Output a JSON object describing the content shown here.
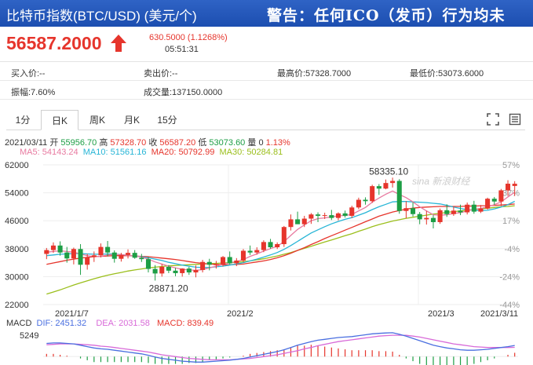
{
  "header": {
    "title": "比特币指数(BTC/USD) (美元/个)",
    "warning": "警告：任何ICO（发币）行为均未"
  },
  "quote": {
    "price": "56587.2000",
    "change": "630.5000 (1.1268%)",
    "time": "05:51:31"
  },
  "stats": {
    "bid": "买入价:--",
    "ask": "卖出价:--",
    "high": "最高价:57328.7000",
    "low": "最低价:53073.6000",
    "amplitude": "振幅:7.60%",
    "volume": "成交量:137150.0000"
  },
  "tabs": [
    "1分",
    "日K",
    "周K",
    "月K",
    "15分"
  ],
  "active_tab": "日K",
  "ohlc": {
    "date": "2021/03/11",
    "open_label": "开",
    "open": "55956.70",
    "high_label": "高",
    "high": "57328.70",
    "close_label": "收",
    "close": "56587.20",
    "low_label": "低",
    "low": "53073.60",
    "vol_label": "量",
    "vol": "0",
    "pct": "1.13%"
  },
  "ma": {
    "ma5": "MA5: 54143.24",
    "ma10": "MA10: 51561.16",
    "ma20": "MA20: 50792.99",
    "ma30": "MA30: 50284.81"
  },
  "macd": {
    "label": "MACD",
    "dif": "DIF: 2451.32",
    "dea": "DEA: 2031.58",
    "macd": "MACD: 839.49",
    "axis_max": "5249"
  },
  "watermark": "sina 新浪财经",
  "colors": {
    "up": "#e6352c",
    "down": "#1d9e45",
    "ma5": "#e87aa0",
    "ma10": "#27b5d6",
    "ma20": "#e6352c",
    "ma30": "#9bbf1c",
    "dif": "#4a6fe0",
    "dea": "#d86ad8"
  },
  "chart_data": {
    "type": "candlestick",
    "y_ticks": [
      "62000",
      "54000",
      "46000",
      "38000",
      "30000",
      "22000"
    ],
    "pct_ticks": [
      "57%",
      "37%",
      "17%",
      "-4%",
      "-24%",
      "-44%"
    ],
    "x_labels": [
      "2021/1/7",
      "2021/2",
      "2021/3",
      "2021/3/11"
    ],
    "annotations": {
      "max": "58335.10",
      "min": "28871.20"
    },
    "ylim": [
      22000,
      62000
    ],
    "candles": [
      [
        36500,
        38200,
        35000,
        37600
      ],
      [
        37600,
        39800,
        36800,
        38900
      ],
      [
        38900,
        40100,
        36000,
        36900
      ],
      [
        36900,
        38500,
        34000,
        35200
      ],
      [
        35200,
        38300,
        33500,
        37900
      ],
      [
        37900,
        39300,
        30500,
        33400
      ],
      [
        33400,
        36500,
        32000,
        35600
      ],
      [
        35600,
        37200,
        34200,
        36100
      ],
      [
        36100,
        39500,
        35500,
        38500
      ],
      [
        38500,
        40200,
        35800,
        36900
      ],
      [
        36900,
        37500,
        34000,
        35100
      ],
      [
        35100,
        36800,
        34300,
        36200
      ],
      [
        36200,
        37800,
        35200,
        36800
      ],
      [
        36800,
        37600,
        35100,
        35400
      ],
      [
        35400,
        36500,
        34200,
        35000
      ],
      [
        35000,
        35600,
        31200,
        32200
      ],
      [
        32200,
        33300,
        28871,
        30900
      ],
      [
        30900,
        33600,
        30000,
        32800
      ],
      [
        32800,
        33300,
        31000,
        31700
      ],
      [
        31700,
        32500,
        30100,
        31000
      ],
      [
        31000,
        32400,
        30000,
        32300
      ],
      [
        32300,
        32800,
        30500,
        31200
      ],
      [
        31200,
        33200,
        29800,
        31900
      ],
      [
        31900,
        34800,
        31200,
        34200
      ],
      [
        34200,
        35100,
        31800,
        33400
      ],
      [
        33400,
        34500,
        32300,
        33500
      ],
      [
        33500,
        35900,
        32900,
        35600
      ],
      [
        35600,
        37200,
        33500,
        33800
      ],
      [
        33800,
        35300,
        33000,
        34600
      ],
      [
        34600,
        37900,
        34100,
        37400
      ],
      [
        37400,
        38900,
        36200,
        36900
      ],
      [
        36900,
        38400,
        36300,
        37600
      ],
      [
        37600,
        40400,
        37000,
        39900
      ],
      [
        39900,
        40800,
        38000,
        38400
      ],
      [
        38400,
        39800,
        37900,
        39300
      ],
      [
        39300,
        44500,
        38500,
        44200
      ],
      [
        44200,
        47800,
        43200,
        46400
      ],
      [
        46400,
        48600,
        45200,
        45000
      ],
      [
        45000,
        47400,
        44200,
        46600
      ],
      [
        46600,
        48200,
        45100,
        47800
      ],
      [
        47800,
        48400,
        45600,
        47400
      ],
      [
        47400,
        48300,
        46500,
        47600
      ],
      [
        47600,
        49100,
        46200,
        46800
      ],
      [
        46800,
        48400,
        46100,
        48100
      ],
      [
        48100,
        48900,
        46900,
        47400
      ],
      [
        47400,
        50300,
        46800,
        49800
      ],
      [
        49800,
        52600,
        49300,
        52000
      ],
      [
        52000,
        52700,
        50600,
        51600
      ],
      [
        51600,
        56300,
        51100,
        55900
      ],
      [
        55900,
        56500,
        53400,
        55200
      ],
      [
        55200,
        57800,
        55000,
        56800
      ],
      [
        56800,
        58335,
        55500,
        57400
      ],
      [
        57400,
        57900,
        48000,
        48800
      ],
      [
        48800,
        51600,
        46700,
        49600
      ],
      [
        49600,
        51300,
        47200,
        47900
      ],
      [
        47900,
        48500,
        45000,
        46400
      ],
      [
        46400,
        48800,
        44900,
        46800
      ],
      [
        46800,
        47600,
        43800,
        45600
      ],
      [
        45600,
        49500,
        45100,
        49000
      ],
      [
        49000,
        50700,
        47100,
        47900
      ],
      [
        47900,
        50200,
        47400,
        48900
      ],
      [
        48900,
        50600,
        47600,
        48400
      ],
      [
        48400,
        51200,
        47800,
        50600
      ],
      [
        50600,
        51700,
        48000,
        48600
      ],
      [
        48600,
        50500,
        48200,
        49500
      ],
      [
        49500,
        52600,
        49200,
        52300
      ],
      [
        52300,
        52800,
        50600,
        51500
      ],
      [
        51500,
        55100,
        50200,
        54700
      ],
      [
        54700,
        57600,
        53100,
        56600
      ],
      [
        55956,
        57328,
        53073,
        56587
      ]
    ],
    "ma5": [
      37000,
      37200,
      37400,
      37200,
      37000,
      36500,
      36000,
      35700,
      35800,
      36200,
      36400,
      36300,
      36100,
      35900,
      35600,
      35000,
      34200,
      33600,
      33000,
      32500,
      32100,
      31900,
      31800,
      32000,
      32500,
      33000,
      33500,
      34000,
      34300,
      34900,
      35800,
      36500,
      37300,
      38000,
      38700,
      40000,
      41800,
      43500,
      44800,
      46000,
      46600,
      46800,
      47100,
      47400,
      47500,
      47800,
      48800,
      49800,
      51300,
      52500,
      53600,
      54500,
      53500,
      52600,
      51400,
      50000,
      48800,
      47700,
      47600,
      47700,
      48100,
      48300,
      48800,
      49300,
      49500,
      50000,
      50600,
      51400,
      52800,
      54143
    ],
    "ma10": [
      36000,
      36200,
      36400,
      36500,
      36600,
      36600,
      36500,
      36400,
      36400,
      36500,
      36500,
      36300,
      36100,
      35900,
      35700,
      35400,
      35000,
      34600,
      34100,
      33700,
      33300,
      33000,
      32700,
      32600,
      32600,
      32800,
      33000,
      33300,
      33600,
      34000,
      34500,
      35000,
      35600,
      36200,
      36900,
      37800,
      38900,
      40100,
      41300,
      42500,
      43400,
      44300,
      45100,
      45800,
      46400,
      46900,
      47600,
      48300,
      49200,
      50000,
      50700,
      51400,
      51500,
      51500,
      51400,
      51300,
      51200,
      51000,
      50800,
      50400,
      49900,
      49500,
      49200,
      49000,
      48900,
      49000,
      49400,
      49900,
      50600,
      51561
    ],
    "ma20": [
      33500,
      33900,
      34300,
      34700,
      35000,
      35300,
      35500,
      35700,
      35800,
      35900,
      36000,
      36000,
      36000,
      35900,
      35800,
      35700,
      35500,
      35300,
      35100,
      34900,
      34600,
      34300,
      34000,
      33800,
      33600,
      33500,
      33400,
      33400,
      33500,
      33600,
      33900,
      34200,
      34500,
      34900,
      35400,
      36000,
      36700,
      37500,
      38300,
      39200,
      40000,
      40900,
      41700,
      42500,
      43300,
      44100,
      44900,
      45700,
      46500,
      47300,
      47900,
      48500,
      48900,
      49300,
      49600,
      49800,
      49900,
      50000,
      50100,
      50100,
      50100,
      50100,
      50200,
      50200,
      50300,
      50300,
      50400,
      50500,
      50600,
      50793
    ],
    "ma30": [
      25000,
      25600,
      26200,
      26900,
      27600,
      28200,
      28800,
      29400,
      29900,
      30400,
      30800,
      31200,
      31600,
      31900,
      32200,
      32500,
      32700,
      32900,
      33100,
      33200,
      33300,
      33400,
      33500,
      33600,
      33700,
      33800,
      33900,
      34000,
      34100,
      34300,
      34500,
      34800,
      35100,
      35500,
      35900,
      36400,
      36900,
      37500,
      38100,
      38700,
      39300,
      39900,
      40500,
      41100,
      41700,
      42300,
      43000,
      43600,
      44300,
      44900,
      45400,
      45900,
      46300,
      46700,
      47000,
      47300,
      47600,
      47900,
      48100,
      48400,
      48600,
      48800,
      49000,
      49200,
      49400,
      49600,
      49800,
      50000,
      50100,
      50285
    ],
    "dif": [
      2900,
      3000,
      3000,
      2900,
      2800,
      2500,
      2200,
      1900,
      1700,
      1600,
      1400,
      1200,
      1000,
      800,
      600,
      300,
      -100,
      -400,
      -600,
      -800,
      -1000,
      -1100,
      -1200,
      -1200,
      -1100,
      -1000,
      -900,
      -800,
      -600,
      -400,
      -100,
      200,
      500,
      800,
      1100,
      1500,
      2000,
      2500,
      2900,
      3300,
      3600,
      3800,
      4000,
      4200,
      4300,
      4400,
      4600,
      4800,
      5000,
      5100,
      5200,
      5249,
      4900,
      4500,
      4000,
      3500,
      3000,
      2500,
      2200,
      1900,
      1700,
      1500,
      1400,
      1400,
      1500,
      1600,
      1800,
      2000,
      2200,
      2451
    ],
    "dea": [
      2600,
      2700,
      2800,
      2800,
      2800,
      2700,
      2600,
      2500,
      2300,
      2200,
      2000,
      1800,
      1600,
      1400,
      1200,
      1000,
      700,
      400,
      200,
      0,
      -200,
      -400,
      -500,
      -600,
      -700,
      -700,
      -700,
      -700,
      -600,
      -500,
      -400,
      -200,
      0,
      200,
      400,
      700,
      1000,
      1300,
      1700,
      2000,
      2400,
      2700,
      3000,
      3300,
      3500,
      3700,
      3900,
      4100,
      4300,
      4500,
      4600,
      4700,
      4700,
      4700,
      4500,
      4300,
      4000,
      3700,
      3400,
      3100,
      2800,
      2600,
      2400,
      2200,
      2100,
      2000,
      2000,
      2000,
      2000,
      2032
    ]
  }
}
